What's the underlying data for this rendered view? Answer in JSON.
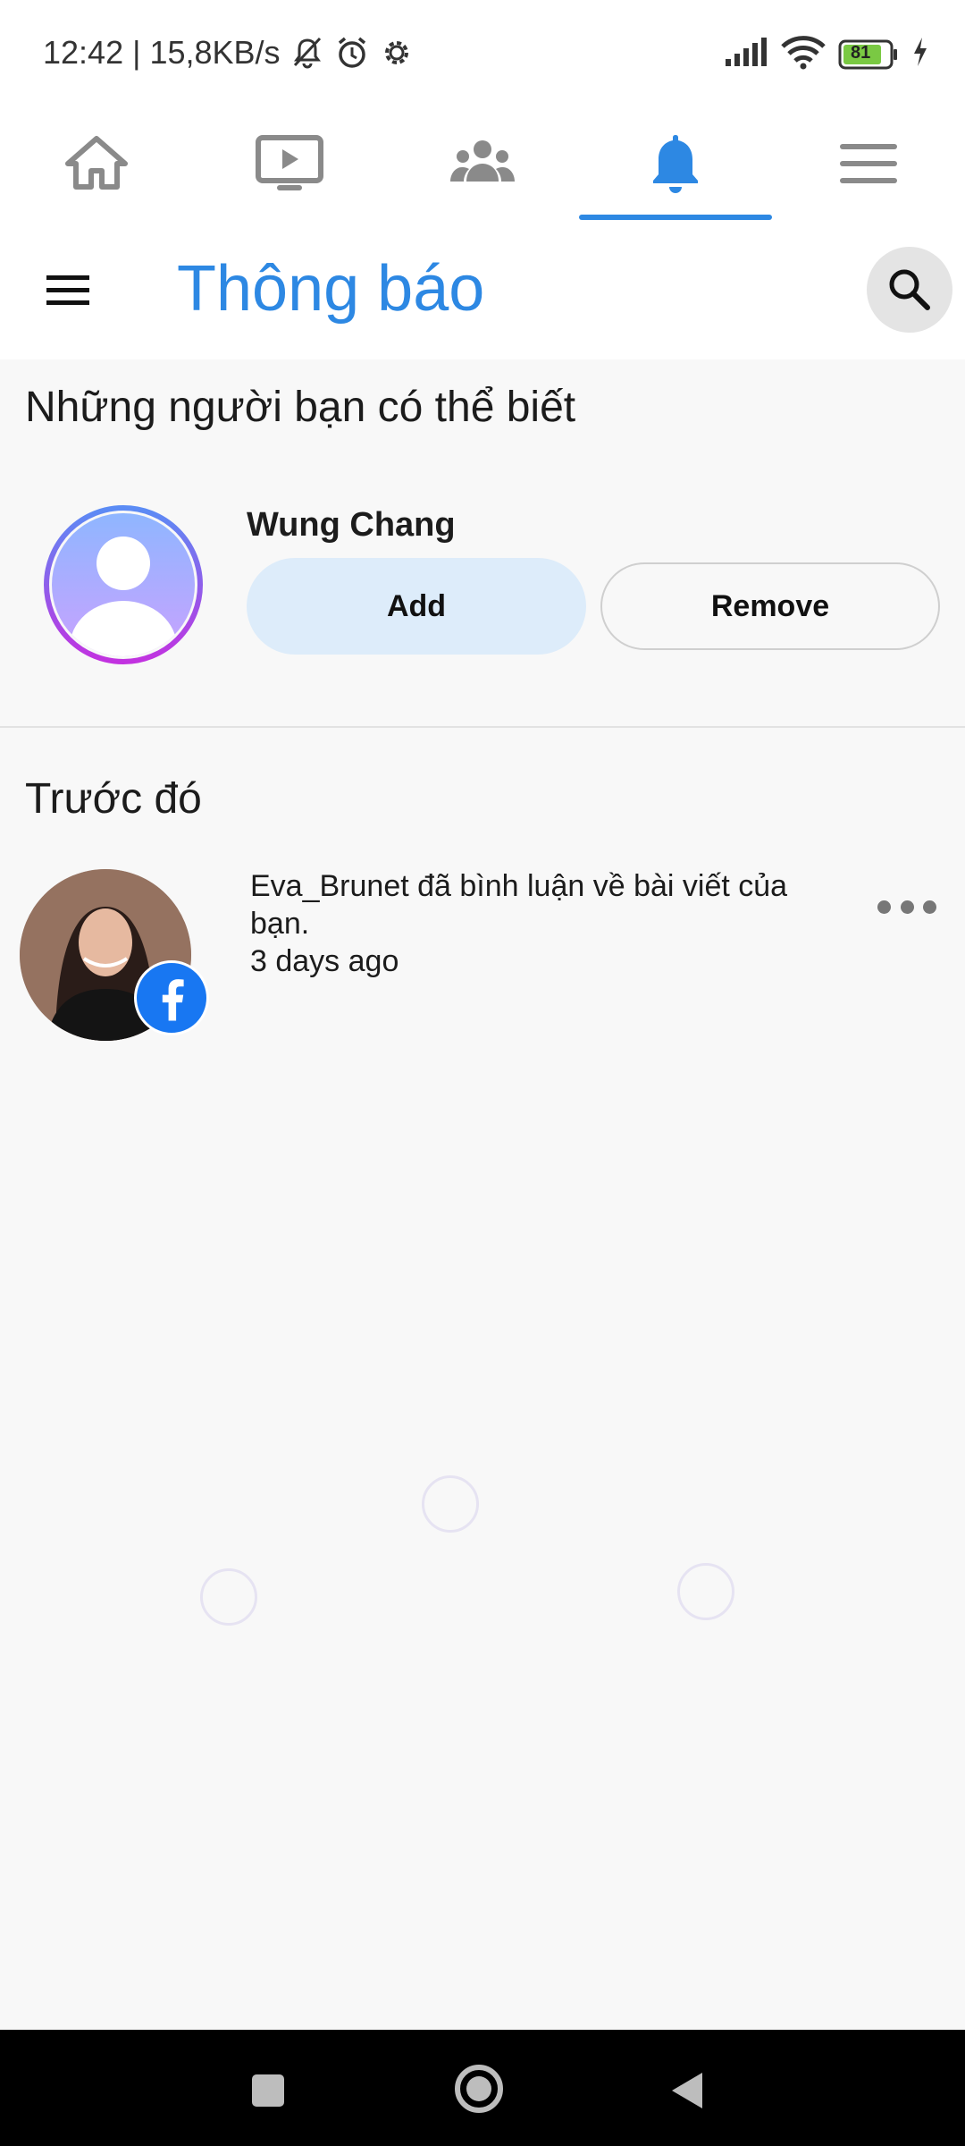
{
  "status_bar": {
    "time": "12:42",
    "speed": "| 15,8KB/s",
    "battery": "81",
    "icons": [
      "mute-bell-icon",
      "alarm-icon",
      "settings-icon",
      "signal-icon",
      "wifi-icon",
      "battery-icon",
      "charging-icon"
    ]
  },
  "top_nav": {
    "tabs": [
      {
        "icon": "home-icon",
        "active": false
      },
      {
        "icon": "video-icon",
        "active": false
      },
      {
        "icon": "groups-icon",
        "active": false
      },
      {
        "icon": "bell-icon",
        "active": true
      },
      {
        "icon": "menu-icon",
        "active": false
      }
    ],
    "accent": "#2d88e3"
  },
  "header": {
    "title": "Thông báo"
  },
  "suggestions": {
    "section_title": "Những người bạn có thể biết",
    "people": [
      {
        "name": "Wung Chang",
        "add_label": "Add",
        "remove_label": "Remove"
      }
    ]
  },
  "earlier": {
    "section_title": "Trước đó",
    "notifications": [
      {
        "text": "Eva_Brunet đã bình luận về bài viết của bạn.",
        "time": "3 days ago",
        "badge": "facebook-icon"
      }
    ]
  },
  "colors": {
    "accent": "#2d88e3",
    "add_button_bg": "#ddecfa",
    "facebook_blue": "#1877f2"
  }
}
